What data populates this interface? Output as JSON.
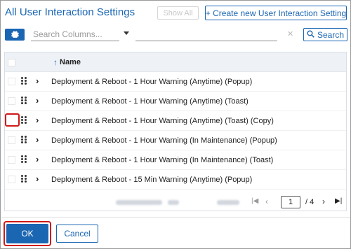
{
  "header": {
    "title": "All User Interaction Settings",
    "show_all_label": "Show All",
    "create_label": "+ Create new User Interaction Setting"
  },
  "toolbar": {
    "gear_icon": "gear-icon",
    "search_columns_placeholder": "Search Columns...",
    "clear_icon": "✕",
    "search_label": "Search",
    "search_icon": "search-icon"
  },
  "grid": {
    "column_name": "Name",
    "sort_icon": "↑",
    "rows": [
      {
        "label": "Deployment & Reboot - 1 Hour Warning (Anytime) (Popup)",
        "highlight": false
      },
      {
        "label": "Deployment & Reboot - 1 Hour Warning (Anytime) (Toast)",
        "highlight": false
      },
      {
        "label": "Deployment & Reboot - 1 Hour Warning (Anytime) (Toast) (Copy)",
        "highlight": true
      },
      {
        "label": "Deployment & Reboot - 1 Hour Warning (In Maintenance) (Popup)",
        "highlight": false
      },
      {
        "label": "Deployment & Reboot - 1 Hour Warning (In Maintenance) (Toast)",
        "highlight": false
      },
      {
        "label": "Deployment & Reboot - 15 Min Warning (Anytime) (Popup)",
        "highlight": false
      }
    ]
  },
  "pager": {
    "current_page": "1",
    "total_pages": "/ 4"
  },
  "footer": {
    "ok_label": "OK",
    "cancel_label": "Cancel"
  },
  "colors": {
    "accent": "#1a66b3",
    "highlight": "#d01818"
  }
}
